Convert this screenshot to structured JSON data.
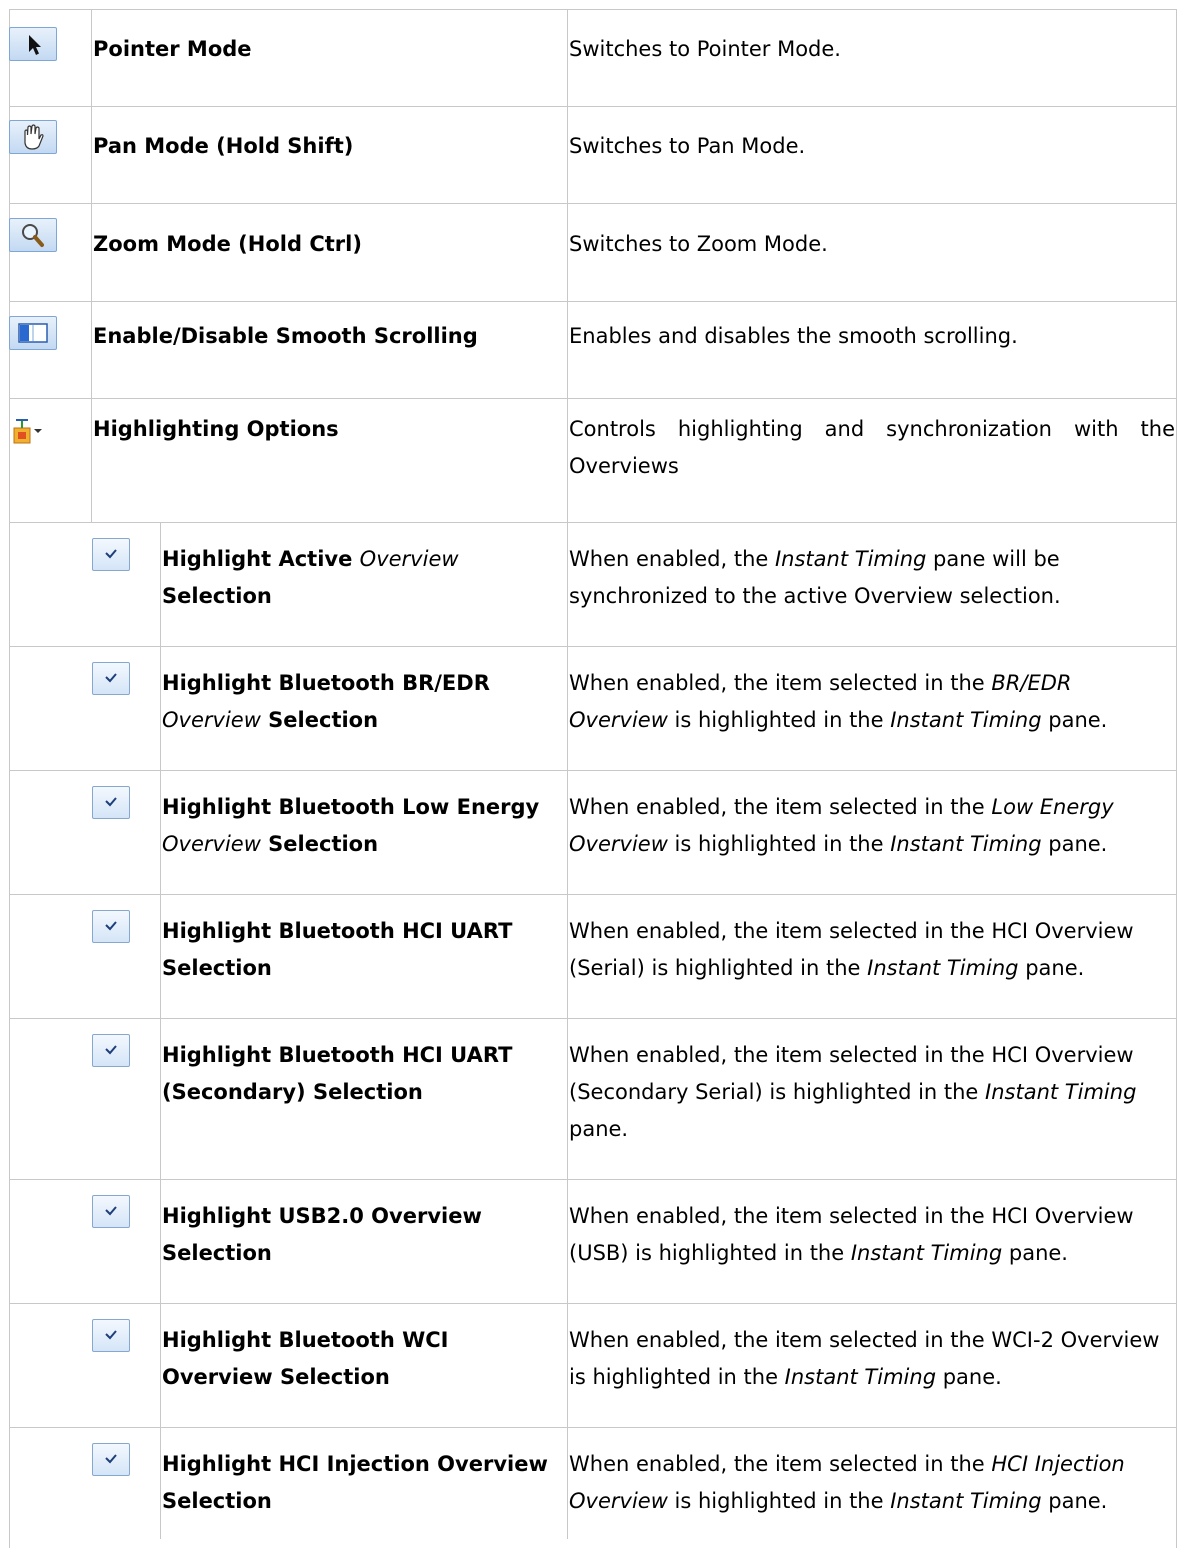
{
  "rows": [
    {
      "name": "Pointer Mode",
      "desc": "Switches to Pointer Mode.",
      "icon": "pointer-icon"
    },
    {
      "name": "Pan Mode (Hold Shift)",
      "desc": "Switches to Pan Mode.",
      "icon": "hand-icon"
    },
    {
      "name": "Zoom Mode (Hold Ctrl)",
      "desc": "Switches to Zoom Mode.",
      "icon": "magnifier-icon"
    },
    {
      "name": "Enable/Disable Smooth Scrolling",
      "desc": "Enables and disables the smooth scrolling.",
      "icon": "smooth-scrolling-icon"
    },
    {
      "name": "Highlighting Options",
      "desc": "Controls highlighting and synchronization with the Overviews",
      "icon": "highlighting-options-icon"
    }
  ],
  "sub": [
    {
      "n1": "Highlight Active ",
      "n1_it": "Overview",
      "n2": "Selection",
      "d1": "When enabled, the ",
      "d1_it": "Instant Timing",
      "d1b": " pane will be",
      "d2": "synchronized to the active Overview selection."
    },
    {
      "n1": "Highlight Bluetooth BR/EDR",
      "n2_it": "Overview",
      "n2": " Selection",
      "d1": "When enabled, the item selected in the ",
      "d1_it": "BR/EDR",
      "d2_it": "Overview",
      "d2": " is highlighted in the ",
      "d2_it2": "Instant Timing",
      "d2b": " pane."
    },
    {
      "n1": "Highlight Bluetooth  Low Energy",
      "n2_it": "Overview",
      "n2": " Selection",
      "d1": "When enabled, the item selected in the ",
      "d1_it": "Low Energy",
      "d2_it": "Overview",
      "d2": " is highlighted in the ",
      "d2_it2": "Instant Timing",
      "d2b": " pane."
    },
    {
      "n1": "Highlight Bluetooth HCI UART",
      "n2": "Selection",
      "d1": "When enabled, the item selected in the HCI Overview",
      "d2": "(Serial) is highlighted in the ",
      "d2_it": "Instant Timing",
      "d2b": " pane."
    },
    {
      "n1": "Highlight Bluetooth HCI UART",
      "n2": "(Secondary) Selection",
      "d1": "When enabled, the item selected in the HCI Overview",
      "d2": "(Secondary Serial) is highlighted in the ",
      "d2_it": "Instant Timing",
      "d3": "pane."
    },
    {
      "n1": "Highlight USB2.0 Overview",
      "n2": "Selection",
      "d1": "When enabled, the item selected in the HCI Overview",
      "d2": "(USB) is highlighted in the ",
      "d2_it": "Instant Timing",
      "d2b": " pane."
    },
    {
      "n1": "Highlight Bluetooth WCI",
      "n2": "Overview Selection",
      "d1": "When enabled, the item selected in the WCI-2 Overview",
      "d2": "is highlighted in the ",
      "d2_it": "Instant Timing",
      "d2b": " pane."
    },
    {
      "n1": "Highlight HCI Injection Overview",
      "n2": "Selection",
      "d1": "When enabled, the item selected in the ",
      "d1_it": "HCI Injection",
      "d2_it": "Overview",
      "d2": " is highlighted in the ",
      "d2_it2": "Instant Timing",
      "d2b": " pane."
    }
  ]
}
